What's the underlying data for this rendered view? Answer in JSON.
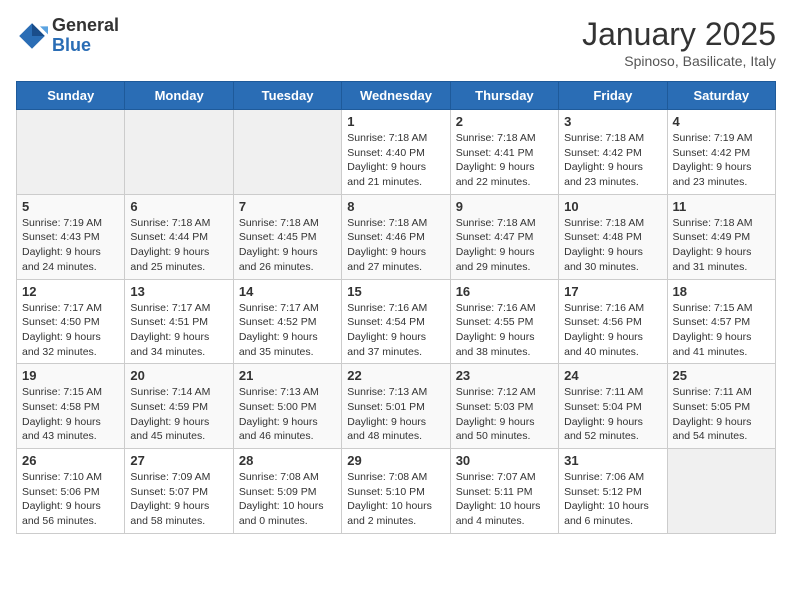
{
  "logo": {
    "general": "General",
    "blue": "Blue"
  },
  "title": "January 2025",
  "location": "Spinoso, Basilicate, Italy",
  "weekdays": [
    "Sunday",
    "Monday",
    "Tuesday",
    "Wednesday",
    "Thursday",
    "Friday",
    "Saturday"
  ],
  "weeks": [
    [
      {
        "day": "",
        "info": ""
      },
      {
        "day": "",
        "info": ""
      },
      {
        "day": "",
        "info": ""
      },
      {
        "day": "1",
        "info": "Sunrise: 7:18 AM\nSunset: 4:40 PM\nDaylight: 9 hours\nand 21 minutes."
      },
      {
        "day": "2",
        "info": "Sunrise: 7:18 AM\nSunset: 4:41 PM\nDaylight: 9 hours\nand 22 minutes."
      },
      {
        "day": "3",
        "info": "Sunrise: 7:18 AM\nSunset: 4:42 PM\nDaylight: 9 hours\nand 23 minutes."
      },
      {
        "day": "4",
        "info": "Sunrise: 7:19 AM\nSunset: 4:42 PM\nDaylight: 9 hours\nand 23 minutes."
      }
    ],
    [
      {
        "day": "5",
        "info": "Sunrise: 7:19 AM\nSunset: 4:43 PM\nDaylight: 9 hours\nand 24 minutes."
      },
      {
        "day": "6",
        "info": "Sunrise: 7:18 AM\nSunset: 4:44 PM\nDaylight: 9 hours\nand 25 minutes."
      },
      {
        "day": "7",
        "info": "Sunrise: 7:18 AM\nSunset: 4:45 PM\nDaylight: 9 hours\nand 26 minutes."
      },
      {
        "day": "8",
        "info": "Sunrise: 7:18 AM\nSunset: 4:46 PM\nDaylight: 9 hours\nand 27 minutes."
      },
      {
        "day": "9",
        "info": "Sunrise: 7:18 AM\nSunset: 4:47 PM\nDaylight: 9 hours\nand 29 minutes."
      },
      {
        "day": "10",
        "info": "Sunrise: 7:18 AM\nSunset: 4:48 PM\nDaylight: 9 hours\nand 30 minutes."
      },
      {
        "day": "11",
        "info": "Sunrise: 7:18 AM\nSunset: 4:49 PM\nDaylight: 9 hours\nand 31 minutes."
      }
    ],
    [
      {
        "day": "12",
        "info": "Sunrise: 7:17 AM\nSunset: 4:50 PM\nDaylight: 9 hours\nand 32 minutes."
      },
      {
        "day": "13",
        "info": "Sunrise: 7:17 AM\nSunset: 4:51 PM\nDaylight: 9 hours\nand 34 minutes."
      },
      {
        "day": "14",
        "info": "Sunrise: 7:17 AM\nSunset: 4:52 PM\nDaylight: 9 hours\nand 35 minutes."
      },
      {
        "day": "15",
        "info": "Sunrise: 7:16 AM\nSunset: 4:54 PM\nDaylight: 9 hours\nand 37 minutes."
      },
      {
        "day": "16",
        "info": "Sunrise: 7:16 AM\nSunset: 4:55 PM\nDaylight: 9 hours\nand 38 minutes."
      },
      {
        "day": "17",
        "info": "Sunrise: 7:16 AM\nSunset: 4:56 PM\nDaylight: 9 hours\nand 40 minutes."
      },
      {
        "day": "18",
        "info": "Sunrise: 7:15 AM\nSunset: 4:57 PM\nDaylight: 9 hours\nand 41 minutes."
      }
    ],
    [
      {
        "day": "19",
        "info": "Sunrise: 7:15 AM\nSunset: 4:58 PM\nDaylight: 9 hours\nand 43 minutes."
      },
      {
        "day": "20",
        "info": "Sunrise: 7:14 AM\nSunset: 4:59 PM\nDaylight: 9 hours\nand 45 minutes."
      },
      {
        "day": "21",
        "info": "Sunrise: 7:13 AM\nSunset: 5:00 PM\nDaylight: 9 hours\nand 46 minutes."
      },
      {
        "day": "22",
        "info": "Sunrise: 7:13 AM\nSunset: 5:01 PM\nDaylight: 9 hours\nand 48 minutes."
      },
      {
        "day": "23",
        "info": "Sunrise: 7:12 AM\nSunset: 5:03 PM\nDaylight: 9 hours\nand 50 minutes."
      },
      {
        "day": "24",
        "info": "Sunrise: 7:11 AM\nSunset: 5:04 PM\nDaylight: 9 hours\nand 52 minutes."
      },
      {
        "day": "25",
        "info": "Sunrise: 7:11 AM\nSunset: 5:05 PM\nDaylight: 9 hours\nand 54 minutes."
      }
    ],
    [
      {
        "day": "26",
        "info": "Sunrise: 7:10 AM\nSunset: 5:06 PM\nDaylight: 9 hours\nand 56 minutes."
      },
      {
        "day": "27",
        "info": "Sunrise: 7:09 AM\nSunset: 5:07 PM\nDaylight: 9 hours\nand 58 minutes."
      },
      {
        "day": "28",
        "info": "Sunrise: 7:08 AM\nSunset: 5:09 PM\nDaylight: 10 hours\nand 0 minutes."
      },
      {
        "day": "29",
        "info": "Sunrise: 7:08 AM\nSunset: 5:10 PM\nDaylight: 10 hours\nand 2 minutes."
      },
      {
        "day": "30",
        "info": "Sunrise: 7:07 AM\nSunset: 5:11 PM\nDaylight: 10 hours\nand 4 minutes."
      },
      {
        "day": "31",
        "info": "Sunrise: 7:06 AM\nSunset: 5:12 PM\nDaylight: 10 hours\nand 6 minutes."
      },
      {
        "day": "",
        "info": ""
      }
    ]
  ]
}
